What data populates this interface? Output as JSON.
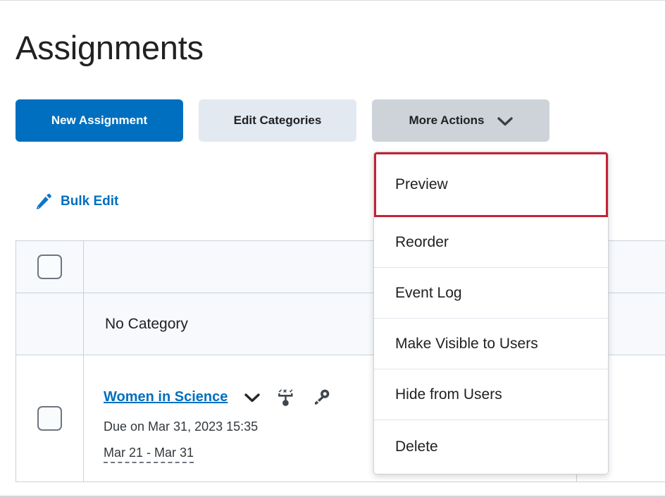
{
  "page": {
    "title": "Assignments"
  },
  "toolbar": {
    "new_assignment_label": "New Assignment",
    "edit_categories_label": "Edit Categories",
    "more_actions_label": "More Actions",
    "more_actions_icon": "chevron-down-icon",
    "colors": {
      "primary": "#006fbf",
      "secondary": "#e3e9f1",
      "more_actions": "#cdd3d9",
      "highlight": "#c12335"
    }
  },
  "bulk_edit": {
    "label": "Bulk Edit",
    "icon": "pencil-edit-icon"
  },
  "more_actions_menu": {
    "highlighted_item": "Preview",
    "items": [
      {
        "label": "Preview",
        "highlighted": true
      },
      {
        "label": "Reorder",
        "highlighted": false
      },
      {
        "label": "Event Log",
        "highlighted": false
      },
      {
        "label": "Make Visible to Users",
        "highlighted": false
      },
      {
        "label": "Hide from Users",
        "highlighted": false
      },
      {
        "label": "Delete",
        "highlighted": false
      }
    ]
  },
  "table": {
    "select_all": {
      "icon": "checkbox-unchecked-icon",
      "checked": false
    },
    "category_row": {
      "name": "No Category"
    },
    "assignment": {
      "checkbox": {
        "icon": "checkbox-unchecked-icon",
        "checked": false
      },
      "title": "Women in Science",
      "context_menu_icon": "chevron-down-icon",
      "release_conditions_icon": "release-conditions-icon",
      "special_access_icon": "key-icon",
      "due": "Due on Mar 31, 2023 15:35",
      "availability_range": "Mar 21 - Mar 31"
    }
  }
}
